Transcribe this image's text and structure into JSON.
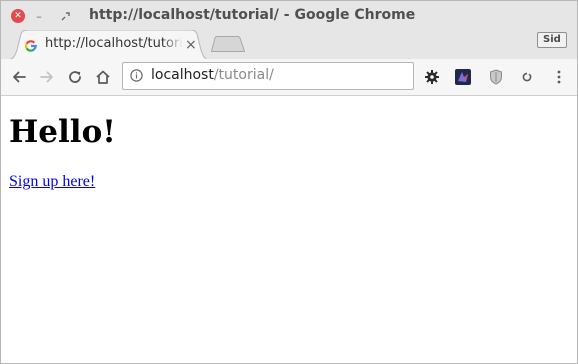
{
  "window": {
    "title": "http://localhost/tutorial/ - Google Chrome",
    "controls": {
      "close_icon": "close-icon",
      "minimize_icon": "minimize-icon",
      "maximize_icon": "maximize-icon"
    }
  },
  "tabs": {
    "active": {
      "title": "http://localhost/tutorial/",
      "favicon": "google-g-icon",
      "close_glyph": "×"
    },
    "new_tab_icon": "new-tab-icon"
  },
  "profile": {
    "label": "Sid"
  },
  "toolbar": {
    "back_icon": "arrow-back-icon",
    "forward_icon": "arrow-forward-icon",
    "reload_icon": "reload-icon",
    "home_icon": "home-icon",
    "omnibox": {
      "info_icon": "info-icon",
      "host": "localhost",
      "path": "/tutorial/"
    },
    "extensions": [
      "gear-extension-icon",
      "dark-extension-icon",
      "shield-extension-icon",
      "circle-extension-icon"
    ],
    "menu_icon": "kebab-menu-icon"
  },
  "page": {
    "heading": "Hello!",
    "link_text": "Sign up here!"
  },
  "colors": {
    "chrome_frame": "#e6e6e6",
    "toolbar": "#f6f6f6",
    "close_button": "#e24c4c",
    "link": "#0000ee"
  }
}
